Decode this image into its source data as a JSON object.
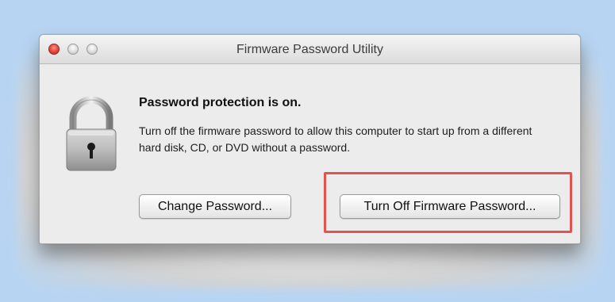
{
  "window": {
    "title": "Firmware Password Utility"
  },
  "icons": {
    "lock": "padlock-icon"
  },
  "dialog": {
    "heading": "Password protection is on.",
    "message": "Turn off the firmware password to allow this computer to start up from a different hard disk, CD, or DVD without a password."
  },
  "buttons": {
    "change_label": "Change Password...",
    "turn_off_label": "Turn Off Firmware Password..."
  },
  "colors": {
    "background": "#b7d5f3",
    "highlight": "#e2544f",
    "close_button": "#e0463a"
  }
}
